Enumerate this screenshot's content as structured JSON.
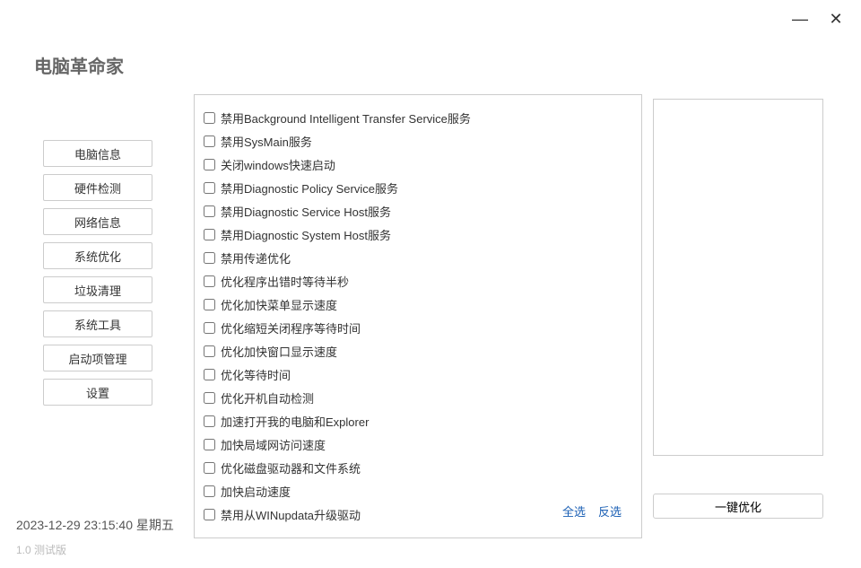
{
  "appTitle": "电脑革命家",
  "windowControls": {
    "minimize": "—",
    "close": "✕"
  },
  "sidebar": {
    "items": [
      {
        "id": "pc-info",
        "label": "电脑信息"
      },
      {
        "id": "hw-check",
        "label": "硬件检测"
      },
      {
        "id": "net-info",
        "label": "网络信息"
      },
      {
        "id": "sys-opt",
        "label": "系统优化"
      },
      {
        "id": "junk-clean",
        "label": "垃圾清理"
      },
      {
        "id": "sys-tools",
        "label": "系统工具"
      },
      {
        "id": "startup",
        "label": "启动项管理"
      },
      {
        "id": "settings",
        "label": "设置"
      }
    ]
  },
  "optimize": {
    "items": [
      {
        "label": "禁用Background Intelligent Transfer Service服务",
        "checked": false
      },
      {
        "label": "禁用SysMain服务",
        "checked": false
      },
      {
        "label": "关闭windows快速启动",
        "checked": false
      },
      {
        "label": "禁用Diagnostic Policy Service服务",
        "checked": false
      },
      {
        "label": "禁用Diagnostic Service Host服务",
        "checked": false
      },
      {
        "label": "禁用Diagnostic System Host服务",
        "checked": false
      },
      {
        "label": "禁用传递优化",
        "checked": false
      },
      {
        "label": "优化程序出错时等待半秒",
        "checked": false
      },
      {
        "label": "优化加快菜单显示速度",
        "checked": false
      },
      {
        "label": "优化缩短关闭程序等待时间",
        "checked": false
      },
      {
        "label": "优化加快窗口显示速度",
        "checked": false
      },
      {
        "label": "优化等待时间",
        "checked": false
      },
      {
        "label": "优化开机自动检测",
        "checked": false
      },
      {
        "label": "加速打开我的电脑和Explorer",
        "checked": false
      },
      {
        "label": "加快局域网访问速度",
        "checked": false
      },
      {
        "label": "优化磁盘驱动器和文件系统",
        "checked": false
      },
      {
        "label": "加快启动速度",
        "checked": false
      },
      {
        "label": "禁用从WINupdata升级驱动",
        "checked": false
      }
    ],
    "selectAll": "全选",
    "invertSelect": "反选",
    "optimizeButton": "一键优化"
  },
  "footer": {
    "datetime": "2023-12-29 23:15:40  星期五",
    "version": "1.0  测试版"
  }
}
